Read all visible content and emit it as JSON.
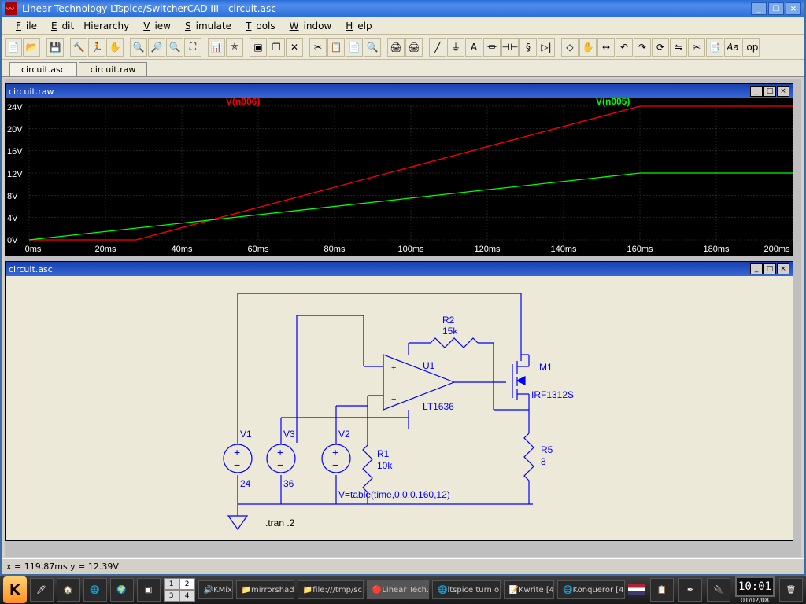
{
  "title": "Linear Technology LTspice/SwitcherCAD III - circuit.asc",
  "menu": {
    "file": "File",
    "edit": "Edit",
    "hierarchy": "Hierarchy",
    "view": "View",
    "simulate": "Simulate",
    "tools": "Tools",
    "window": "Window",
    "help": "Help"
  },
  "tabs": {
    "t1": "circuit.asc",
    "t2": "circuit.raw"
  },
  "raw_title": "circuit.raw",
  "asc_title": "circuit.asc",
  "status": "x = 119.87ms    y = 12.39V",
  "chart_data": {
    "type": "line",
    "xlabel_unit": "ms",
    "ylabel_unit": "V",
    "ylim": [
      0,
      24
    ],
    "xlim": [
      0,
      200
    ],
    "x_ticks": [
      "0ms",
      "20ms",
      "40ms",
      "60ms",
      "80ms",
      "100ms",
      "120ms",
      "140ms",
      "160ms",
      "180ms",
      "200ms"
    ],
    "y_ticks": [
      "0V",
      "4V",
      "8V",
      "12V",
      "16V",
      "20V",
      "24V"
    ],
    "series": [
      {
        "name": "V(n006)",
        "color": "#ff0000",
        "x": [
          0,
          28,
          160,
          200
        ],
        "y": [
          0,
          0,
          24,
          24
        ]
      },
      {
        "name": "V(n005)",
        "color": "#00ff00",
        "x": [
          0,
          160,
          200
        ],
        "y": [
          0,
          12,
          12
        ]
      }
    ]
  },
  "schematic": {
    "R2": {
      "name": "R2",
      "value": "15k"
    },
    "U1": {
      "name": "U1",
      "part": "LT1636"
    },
    "M1": {
      "name": "M1",
      "part": "IRF1312S"
    },
    "R5": {
      "name": "R5",
      "value": "8"
    },
    "V1": {
      "name": "V1",
      "value": "24"
    },
    "V3": {
      "name": "V3",
      "value": "36"
    },
    "V2": {
      "name": "V2",
      "expr": "V=table(time,0,0,0.160,12)"
    },
    "R1": {
      "name": "R1",
      "value": "10k"
    },
    "tran": ".tran .2"
  },
  "taskbar": {
    "kmix": "KMix",
    "mirror": "mirrorshade",
    "file": "file:///tmp/sc…",
    "ltspice": "Linear Tech…",
    "ltspice2": "ltspice turn o…",
    "kwrite": "Kwrite [4]",
    "konq": "Konqueror [4…",
    "clock": "10:01",
    "date": "01/02/08"
  }
}
